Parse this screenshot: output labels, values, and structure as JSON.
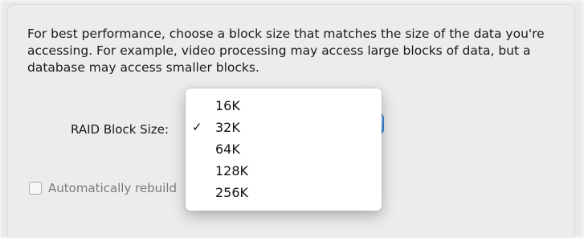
{
  "sheet": {
    "description": "For best performance, choose a block size that matches the size of the data you're accessing. For example, video processing may access large blocks of data, but a database may access smaller blocks.",
    "raid_block_size_label": "RAID Block Size:",
    "auto_rebuild_label": "Automatically rebuild"
  },
  "menu": {
    "selected_mark": "✓",
    "items": [
      {
        "label": "16K",
        "selected": false
      },
      {
        "label": "32K",
        "selected": true
      },
      {
        "label": "64K",
        "selected": false
      },
      {
        "label": "128K",
        "selected": false
      },
      {
        "label": "256K",
        "selected": false
      }
    ]
  },
  "colors": {
    "accent": "#3f8fe6",
    "sheet_background": "#ececec",
    "menu_background": "#ffffff"
  }
}
